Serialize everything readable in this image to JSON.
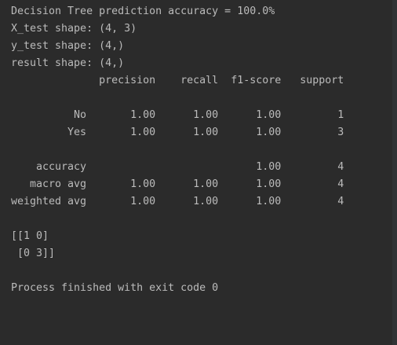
{
  "console": {
    "lines": [
      "Decision Tree prediction accuracy = 100.0%",
      "X_test shape: (4, 3)",
      "y_test shape: (4,)",
      "result shape: (4,)",
      "              precision    recall  f1-score   support",
      "",
      "          No       1.00      1.00      1.00         1",
      "         Yes       1.00      1.00      1.00         3",
      "",
      "    accuracy                           1.00         4",
      "   macro avg       1.00      1.00      1.00         4",
      "weighted avg       1.00      1.00      1.00         4",
      "",
      "[[1 0]",
      " [0 3]]",
      "",
      "Process finished with exit code 0"
    ]
  },
  "colors": {
    "background": "#2b2b2b",
    "text": "#bbbbbb"
  }
}
